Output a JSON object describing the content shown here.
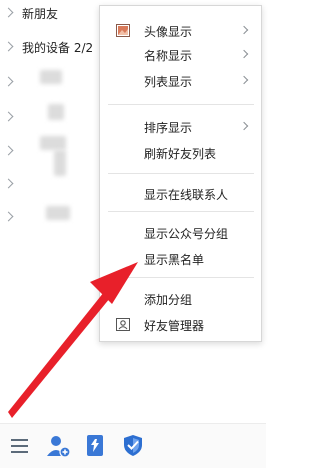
{
  "contacts": {
    "groups": [
      {
        "label": "新朋友"
      },
      {
        "label": "我的设备 2/2"
      }
    ]
  },
  "menu": {
    "items": [
      {
        "label": "头像显示",
        "icon": "avatar-image-icon",
        "submenu": true
      },
      {
        "label": "名称显示",
        "submenu": true
      },
      {
        "label": "列表显示",
        "submenu": true
      },
      {
        "label": "排序显示",
        "submenu": true
      },
      {
        "label": "刷新好友列表",
        "submenu": false
      },
      {
        "label": "显示在线联系人",
        "submenu": false
      },
      {
        "label": "显示公众号分组",
        "submenu": false
      },
      {
        "label": "显示黑名单",
        "submenu": false
      },
      {
        "label": "添加分组",
        "submenu": false
      },
      {
        "label": "好友管理器",
        "icon": "friend-manager-icon",
        "submenu": false
      }
    ]
  },
  "toolbar": {
    "icons": [
      "menu-icon",
      "add-friend-icon",
      "app-icon",
      "security-shield-icon"
    ]
  },
  "colors": {
    "annotation_arrow": "#e8202a",
    "menu_border": "#d7d7d7",
    "shield_blue": "#2d6fd1"
  }
}
